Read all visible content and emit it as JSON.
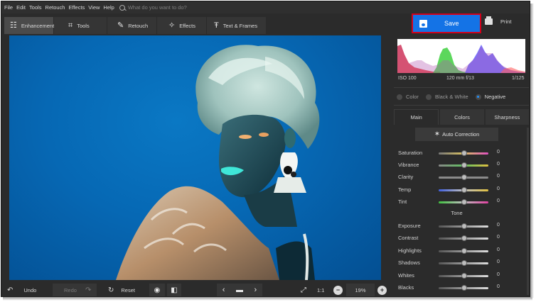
{
  "menu": {
    "items": [
      "File",
      "Edit",
      "Tools",
      "Retouch",
      "Effects",
      "View",
      "Help"
    ],
    "search_placeholder": "What do you want to do?"
  },
  "toolbar": {
    "tabs": [
      {
        "label": "Enhancement",
        "icon": "sliders-icon",
        "active": true
      },
      {
        "label": "Tools",
        "icon": "crop-icon"
      },
      {
        "label": "Retouch",
        "icon": "brush-icon"
      },
      {
        "label": "Effects",
        "icon": "magic-wand-icon"
      },
      {
        "label": "Text & Frames",
        "icon": "text-icon"
      }
    ],
    "save_label": "Save",
    "print_label": "Print"
  },
  "colors": {
    "accent": "#1473e6",
    "highlight": "#d4001a",
    "background": "#2b2b2b"
  },
  "histogram": {
    "iso": "ISO 100",
    "lens": "120 mm f/13",
    "shutter": "1/125"
  },
  "color_modes": {
    "options": [
      "Color",
      "Black & White",
      "Negative"
    ],
    "selected": "Negative"
  },
  "panel_tabs": [
    "Main",
    "Colors",
    "Sharpness"
  ],
  "auto_correction_label": "Auto Correction",
  "sliders": [
    {
      "label": "Saturation",
      "value": "0"
    },
    {
      "label": "Vibrance",
      "value": "0"
    },
    {
      "label": "Clarity",
      "value": "0"
    },
    {
      "label": "Temp",
      "value": "0"
    },
    {
      "label": "Tint",
      "value": "0"
    }
  ],
  "tone_label": "Tone",
  "tone_sliders": [
    {
      "label": "Exposure",
      "value": "0"
    },
    {
      "label": "Contrast",
      "value": "0"
    },
    {
      "label": "Highlights",
      "value": "0"
    },
    {
      "label": "Shadows",
      "value": "0"
    },
    {
      "label": "Whites",
      "value": "0"
    },
    {
      "label": "Blacks",
      "value": "0"
    }
  ],
  "bottom": {
    "undo_label": "Undo",
    "redo_label": "Redo",
    "reset_label": "Reset",
    "ratio_label": "1:1",
    "zoom_value": "19%"
  }
}
